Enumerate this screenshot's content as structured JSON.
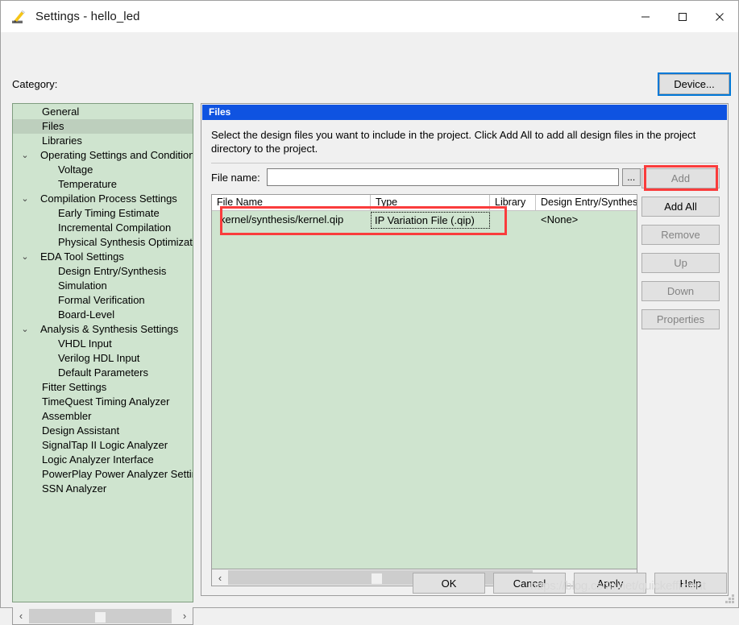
{
  "window": {
    "title": "Settings - hello_led",
    "icon": "pencil-icon",
    "minimize": "—",
    "maximize": "□",
    "close": "✕"
  },
  "category": {
    "label": "Category:",
    "selected": "Files",
    "items": [
      {
        "label": "General",
        "level": 0,
        "chevron": ""
      },
      {
        "label": "Files",
        "level": 0,
        "chevron": ""
      },
      {
        "label": "Libraries",
        "level": 0,
        "chevron": ""
      },
      {
        "label": "Operating Settings and Conditions",
        "level": 0,
        "chevron": "⌄"
      },
      {
        "label": "Voltage",
        "level": 1,
        "chevron": ""
      },
      {
        "label": "Temperature",
        "level": 1,
        "chevron": ""
      },
      {
        "label": "Compilation Process Settings",
        "level": 0,
        "chevron": "⌄"
      },
      {
        "label": "Early Timing Estimate",
        "level": 1,
        "chevron": ""
      },
      {
        "label": "Incremental Compilation",
        "level": 1,
        "chevron": ""
      },
      {
        "label": "Physical Synthesis Optimization",
        "level": 1,
        "chevron": ""
      },
      {
        "label": "EDA Tool Settings",
        "level": 0,
        "chevron": "⌄"
      },
      {
        "label": "Design Entry/Synthesis",
        "level": 1,
        "chevron": ""
      },
      {
        "label": "Simulation",
        "level": 1,
        "chevron": ""
      },
      {
        "label": "Formal Verification",
        "level": 1,
        "chevron": ""
      },
      {
        "label": "Board-Level",
        "level": 1,
        "chevron": ""
      },
      {
        "label": "Analysis & Synthesis Settings",
        "level": 0,
        "chevron": "⌄"
      },
      {
        "label": "VHDL Input",
        "level": 1,
        "chevron": ""
      },
      {
        "label": "Verilog HDL Input",
        "level": 1,
        "chevron": ""
      },
      {
        "label": "Default Parameters",
        "level": 1,
        "chevron": ""
      },
      {
        "label": "Fitter Settings",
        "level": 0,
        "chevron": ""
      },
      {
        "label": "TimeQuest Timing Analyzer",
        "level": 0,
        "chevron": ""
      },
      {
        "label": "Assembler",
        "level": 0,
        "chevron": ""
      },
      {
        "label": "Design Assistant",
        "level": 0,
        "chevron": ""
      },
      {
        "label": "SignalTap II Logic Analyzer",
        "level": 0,
        "chevron": ""
      },
      {
        "label": "Logic Analyzer Interface",
        "level": 0,
        "chevron": ""
      },
      {
        "label": "PowerPlay Power Analyzer Settings",
        "level": 0,
        "chevron": ""
      },
      {
        "label": "SSN Analyzer",
        "level": 0,
        "chevron": ""
      }
    ]
  },
  "device_button": "Device...",
  "content": {
    "header": "Files",
    "description": "Select the design files you want to include in the project. Click Add All to add all design files in the project directory to the project.",
    "filename_label": "File name:",
    "filename_value": "",
    "filename_placeholder": "",
    "browse_label": "...",
    "side_buttons": [
      {
        "label": "Add",
        "enabled": false
      },
      {
        "label": "Add All",
        "enabled": true
      },
      {
        "label": "Remove",
        "enabled": false
      },
      {
        "label": "Up",
        "enabled": false
      },
      {
        "label": "Down",
        "enabled": false
      },
      {
        "label": "Properties",
        "enabled": false
      }
    ],
    "table": {
      "columns": [
        "File Name",
        "Type",
        "Library",
        "Design Entry/Synthes"
      ],
      "rows": [
        {
          "file_name": "kernel/synthesis/kernel.qip",
          "type": "IP Variation File (.qip)",
          "library": "",
          "design_entry": "<None>"
        }
      ]
    }
  },
  "scrollbars": {
    "left_arrow": "‹",
    "right_arrow": "›"
  },
  "footer": {
    "ok": "OK",
    "cancel": "Cancel",
    "apply": "Apply",
    "help": "Help"
  },
  "watermark": "https://blog.csdn.net/quickefficient",
  "colors": {
    "header_blue": "#0f53e1",
    "tree_green": "#cfe4cf",
    "selection_green": "#bdcfbd",
    "annotation_red": "#fa3c3c",
    "focus_blue": "#0078d7"
  }
}
